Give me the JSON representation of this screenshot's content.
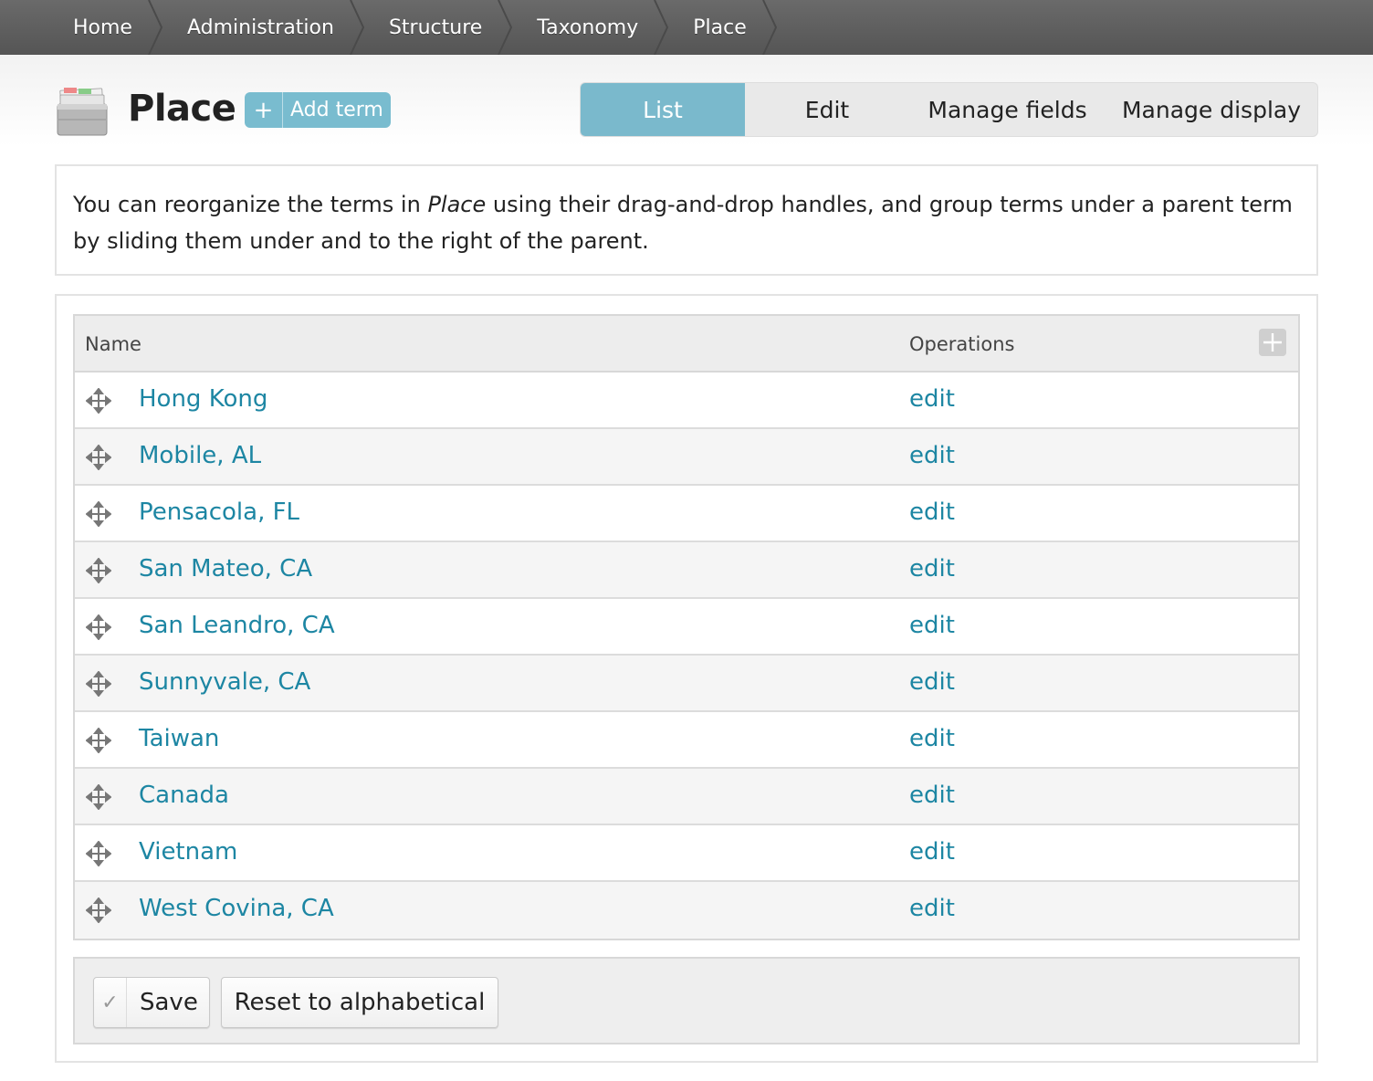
{
  "breadcrumb": [
    "Home",
    "Administration",
    "Structure",
    "Taxonomy",
    "Place"
  ],
  "page": {
    "title": "Place",
    "icon": "taxonomy-drawer-icon",
    "add_term_label": "Add term",
    "add_icon": "plus-icon"
  },
  "tabs": [
    {
      "label": "List",
      "active": true
    },
    {
      "label": "Edit",
      "active": false
    },
    {
      "label": "Manage fields",
      "active": false
    },
    {
      "label": "Manage display",
      "active": false
    }
  ],
  "help": {
    "before": "You can reorganize the terms in ",
    "emphasis": "Place",
    "after": " using their drag-and-drop handles, and group terms under a parent term by sliding them under and to the right of the parent."
  },
  "table": {
    "columns": [
      "Name",
      "Operations"
    ],
    "toggle_icon": "show-row-weights-icon",
    "rows": [
      {
        "name": "Hong Kong",
        "op": "edit"
      },
      {
        "name": "Mobile, AL",
        "op": "edit"
      },
      {
        "name": "Pensacola, FL",
        "op": "edit"
      },
      {
        "name": "San Mateo, CA",
        "op": "edit"
      },
      {
        "name": "San Leandro, CA",
        "op": "edit"
      },
      {
        "name": "Sunnyvale, CA",
        "op": "edit"
      },
      {
        "name": "Taiwan",
        "op": "edit"
      },
      {
        "name": "Canada",
        "op": "edit"
      },
      {
        "name": "Vietnam",
        "op": "edit"
      },
      {
        "name": "West Covina, CA",
        "op": "edit"
      }
    ]
  },
  "actions": {
    "save_label": "Save",
    "reset_label": "Reset to alphabetical"
  },
  "colors": {
    "accent": "#7ab9cc",
    "link": "#1d86a3",
    "crumb_bg": "#5e5e5e"
  }
}
